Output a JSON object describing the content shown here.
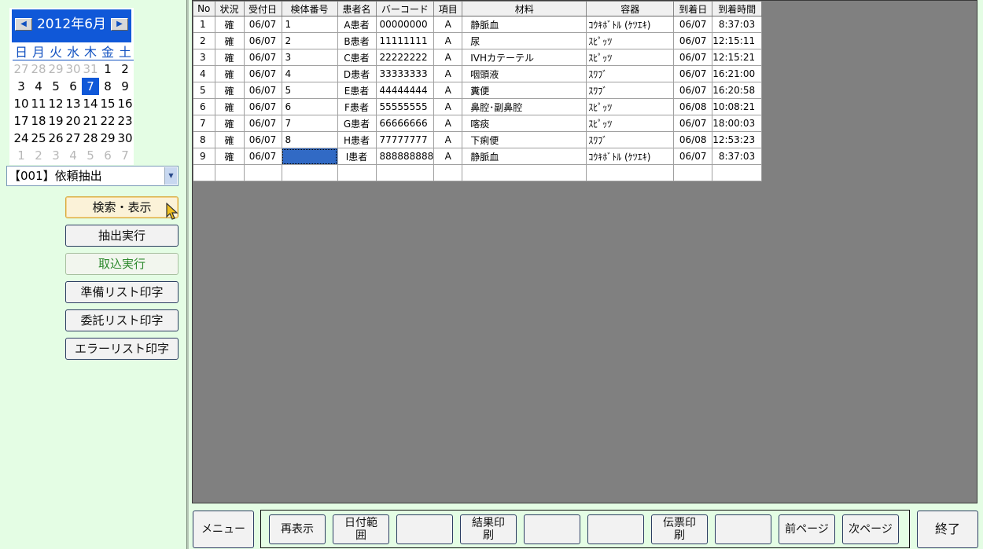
{
  "calendar": {
    "title": "2012年6月",
    "prev_icon": "◀",
    "next_icon": "▶",
    "weekdays": [
      "日",
      "月",
      "火",
      "水",
      "木",
      "金",
      "土"
    ],
    "weeks": [
      [
        "27",
        "28",
        "29",
        "30",
        "31",
        "1",
        "2"
      ],
      [
        "3",
        "4",
        "5",
        "6",
        "7",
        "8",
        "9"
      ],
      [
        "10",
        "11",
        "12",
        "13",
        "14",
        "15",
        "16"
      ],
      [
        "17",
        "18",
        "19",
        "20",
        "21",
        "22",
        "23"
      ],
      [
        "24",
        "25",
        "26",
        "27",
        "28",
        "29",
        "30"
      ],
      [
        "1",
        "2",
        "3",
        "4",
        "5",
        "6",
        "7"
      ]
    ],
    "selected_day": "7",
    "accent_color": "#1058d8"
  },
  "mode_select": {
    "value": "【001】依頼抽出"
  },
  "side_buttons": {
    "search": "検索・表示",
    "extract": "抽出実行",
    "import": "取込実行",
    "prep_list": "準備リスト印字",
    "consign_list": "委託リスト印字",
    "error_list": "エラーリスト印字"
  },
  "grid": {
    "headers": [
      "No",
      "状況",
      "受付日",
      "検体番号",
      "患者名",
      "バーコード",
      "項目",
      "材料",
      "容器",
      "到着日",
      "到着時間"
    ],
    "rows": [
      [
        "1",
        "確",
        "06/07",
        "1",
        "A患者",
        "00000000",
        "A",
        "静脈血",
        "ｺｳｷﾎﾞﾄﾙ (ｹﾂｴｷ)",
        "06/07",
        "8:37:03"
      ],
      [
        "2",
        "確",
        "06/07",
        "2",
        "B患者",
        "11111111",
        "A",
        "尿",
        "ｽﾋﾟｯﾂ",
        "06/07",
        "12:15:11"
      ],
      [
        "3",
        "確",
        "06/07",
        "3",
        "C患者",
        "22222222",
        "A",
        "IVHカテーテル",
        "ｽﾋﾟｯﾂ",
        "06/07",
        "12:15:21"
      ],
      [
        "4",
        "確",
        "06/07",
        "4",
        "D患者",
        "33333333",
        "A",
        "咽頭液",
        "ｽﾜﾌﾞ",
        "06/07",
        "16:21:00"
      ],
      [
        "5",
        "確",
        "06/07",
        "5",
        "E患者",
        "44444444",
        "A",
        "糞便",
        "ｽﾜﾌﾞ",
        "06/07",
        "16:20:58"
      ],
      [
        "6",
        "確",
        "06/07",
        "6",
        "F患者",
        "55555555",
        "A",
        "鼻腔･副鼻腔",
        "ｽﾋﾟｯﾂ",
        "06/08",
        "10:08:21"
      ],
      [
        "7",
        "確",
        "06/07",
        "7",
        "G患者",
        "66666666",
        "A",
        "喀痰",
        "ｽﾋﾟｯﾂ",
        "06/07",
        "18:00:03"
      ],
      [
        "8",
        "確",
        "06/07",
        "8",
        "H患者",
        "77777777",
        "A",
        "下痢便",
        "ｽﾜﾌﾞ",
        "06/08",
        "12:53:23"
      ],
      [
        "9",
        "確",
        "06/07",
        "",
        "I患者",
        "888888888",
        "A",
        "静脈血",
        "ｺｳｷﾎﾞﾄﾙ (ｹﾂｴｷ)",
        "06/07",
        "8:37:03"
      ]
    ]
  },
  "footer": {
    "menu": "メニュー",
    "refresh": "再表示",
    "date_range": "日付範\n囲",
    "result_print": "結果印\n刷",
    "slip_print": "伝票印\n刷",
    "prev_page": "前ページ",
    "next_page": "次ページ",
    "exit": "終了"
  }
}
